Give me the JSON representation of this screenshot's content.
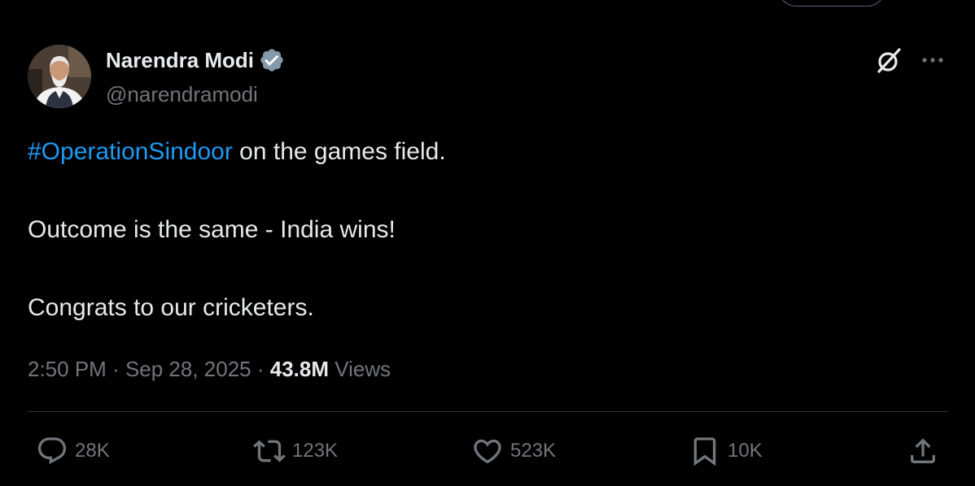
{
  "author": {
    "name": "Narendra Modi",
    "handle": "@narendramodi",
    "verified": true,
    "verified_color": "#829aab"
  },
  "tweet": {
    "hashtag": "#OperationSindoor",
    "line1_rest": " on the games field.",
    "line2": "Outcome is the same - India wins!",
    "line3": "Congrats to our cricketers."
  },
  "meta": {
    "time": "2:50 PM",
    "separator": " · ",
    "date": "Sep 28, 2025",
    "views_count": "43.8M",
    "views_label": " Views"
  },
  "actions": {
    "replies": "28K",
    "reposts": "123K",
    "likes": "523K",
    "bookmarks": "10K"
  },
  "colors": {
    "background": "#000000",
    "text": "#e7e9ea",
    "secondary": "#71767b",
    "link": "#1d9bf0",
    "divider": "#2f3336"
  },
  "icons": {
    "top_right": [
      "grok-icon",
      "more-icon"
    ],
    "action_bar": [
      "reply-icon",
      "repost-icon",
      "like-icon",
      "bookmark-icon",
      "share-icon"
    ]
  }
}
